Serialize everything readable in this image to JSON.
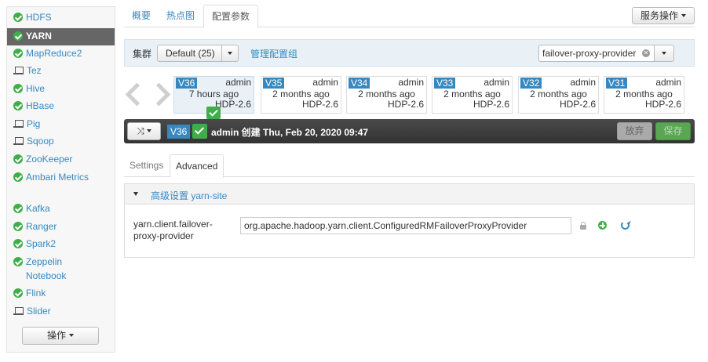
{
  "sidebar": {
    "services": [
      {
        "name": "HDFS",
        "icon": "check-circle-icon",
        "active": false
      },
      {
        "name": "YARN",
        "icon": "check-circle-icon",
        "active": true
      },
      {
        "name": "MapReduce2",
        "icon": "check-circle-icon",
        "active": false
      },
      {
        "name": "Tez",
        "icon": "laptop-icon",
        "active": false
      },
      {
        "name": "Hive",
        "icon": "check-circle-icon",
        "active": false
      },
      {
        "name": "HBase",
        "icon": "check-circle-icon",
        "active": false
      },
      {
        "name": "Pig",
        "icon": "laptop-icon",
        "active": false
      },
      {
        "name": "Sqoop",
        "icon": "laptop-icon",
        "active": false
      },
      {
        "name": "ZooKeeper",
        "icon": "check-circle-icon",
        "active": false
      },
      {
        "name": "Ambari Metrics",
        "icon": "check-circle-icon",
        "active": false
      },
      {
        "name": "Kafka",
        "icon": "check-circle-icon",
        "active": false
      },
      {
        "name": "Ranger",
        "icon": "check-circle-icon",
        "active": false
      },
      {
        "name": "Spark2",
        "icon": "check-circle-icon",
        "active": false
      },
      {
        "name": "Zeppelin Notebook",
        "icon": "check-circle-icon",
        "active": false
      },
      {
        "name": "Flink",
        "icon": "check-circle-icon",
        "active": false
      },
      {
        "name": "Slider",
        "icon": "laptop-icon",
        "active": false
      }
    ],
    "actions_label": "操作"
  },
  "tabs": [
    {
      "label": "概要",
      "active": false
    },
    {
      "label": "热点图",
      "active": false
    },
    {
      "label": "配置参数",
      "active": true
    }
  ],
  "service_actions_label": "服务操作",
  "filter": {
    "cluster_label": "集群",
    "config_group": "Default (25)",
    "manage_link": "管理配置组",
    "search_value": "failover-proxy-provider"
  },
  "versions": [
    {
      "label": "V36",
      "user": "admin",
      "time": "7 hours ago",
      "stack": "HDP-2.6",
      "current": true
    },
    {
      "label": "V35",
      "user": "admin",
      "time": "2 months ago",
      "stack": "HDP-2.6",
      "current": false
    },
    {
      "label": "V34",
      "user": "admin",
      "time": "2 months ago",
      "stack": "HDP-2.6",
      "current": false
    },
    {
      "label": "V33",
      "user": "admin",
      "time": "2 months ago",
      "stack": "HDP-2.6",
      "current": false
    },
    {
      "label": "V32",
      "user": "admin",
      "time": "2 months ago",
      "stack": "HDP-2.6",
      "current": false
    },
    {
      "label": "V31",
      "user": "admin",
      "time": "2 months ago",
      "stack": "HDP-2.6",
      "current": false
    }
  ],
  "version_bar": {
    "version": "V36",
    "info": "admin 创建 Thu, Feb 20, 2020 09:47",
    "discard_label": "放弃",
    "save_label": "保存"
  },
  "settings_tabs": [
    {
      "label": "Settings",
      "active": false
    },
    {
      "label": "Advanced",
      "active": true
    }
  ],
  "panel": {
    "title": "高级设置 yarn-site",
    "property_name": "yarn.client.failover-proxy-provider",
    "property_value": "org.apache.hadoop.yarn.client.ConfiguredRMFailoverProxyProvider"
  },
  "colors": {
    "link": "#3888c0",
    "success": "#3fae49",
    "active_item": "#666666",
    "filter_bg": "#e9f1f7"
  }
}
